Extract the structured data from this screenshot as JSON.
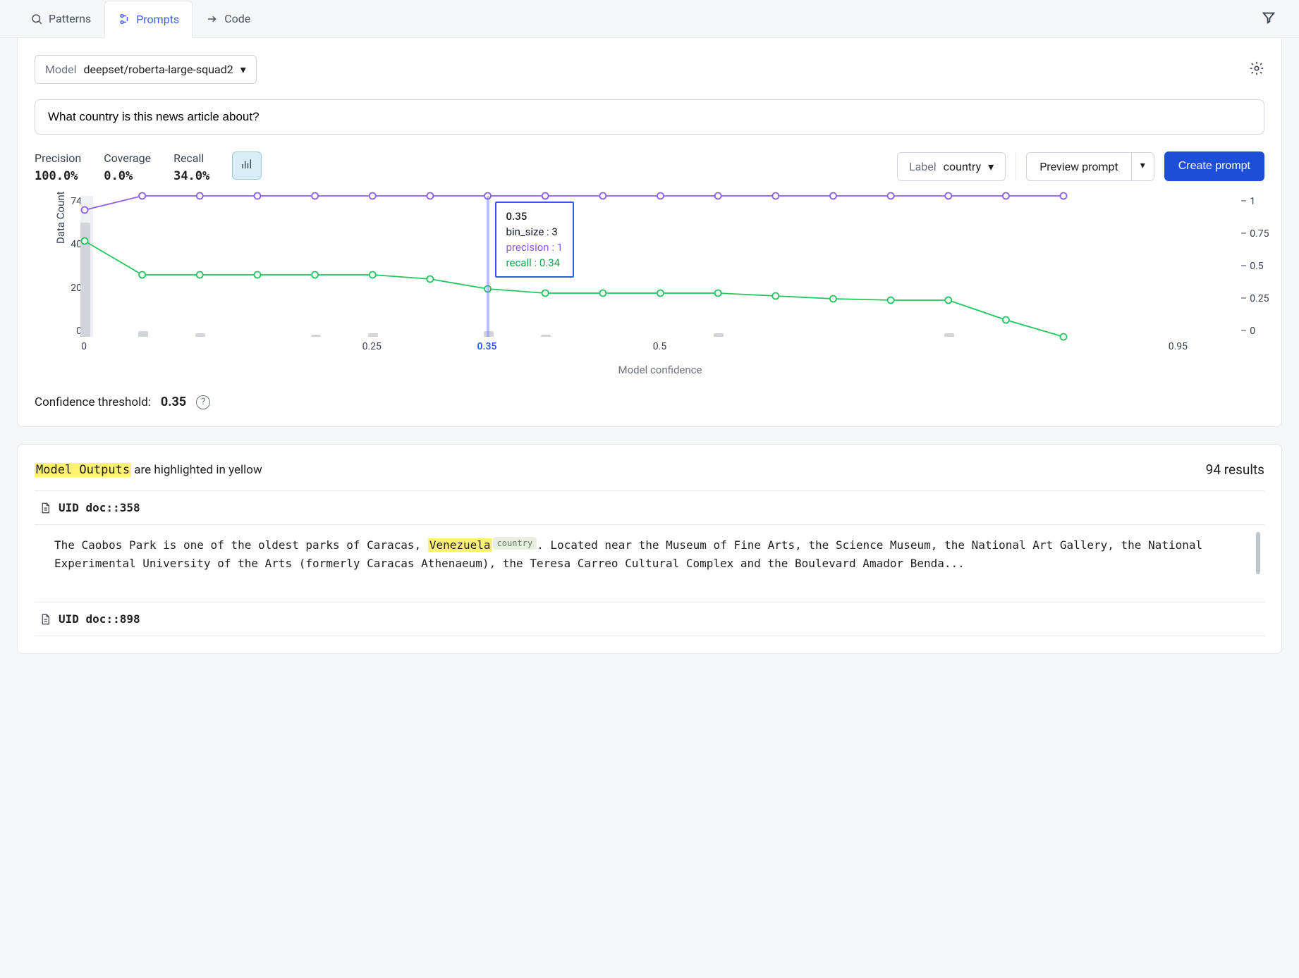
{
  "tabs": {
    "patterns": "Patterns",
    "prompts": "Prompts",
    "code": "Code"
  },
  "model": {
    "label": "Model",
    "value": "deepset/roberta-large-squad2"
  },
  "question": "What country is this news article about?",
  "metrics": {
    "precision_label": "Precision",
    "precision_value": "100.0%",
    "coverage_label": "Coverage",
    "coverage_value": "0.0%",
    "recall_label": "Recall",
    "recall_value": "34.0%"
  },
  "controls": {
    "label_label": "Label",
    "label_value": "country",
    "preview": "Preview prompt",
    "create": "Create prompt"
  },
  "chart_data": {
    "type": "line",
    "xlabel": "Model confidence",
    "ylabel_left": "Data Count",
    "y_left_ticks": [
      74,
      40,
      20,
      0
    ],
    "y_right_ticks": [
      1,
      0.75,
      0.5,
      0.25,
      0
    ],
    "x_ticks": [
      0,
      0.25,
      0.35,
      0.5,
      0.95
    ],
    "selected_x": 0.35,
    "x": [
      0.0,
      0.05,
      0.1,
      0.15,
      0.2,
      0.25,
      0.3,
      0.35,
      0.4,
      0.45,
      0.5,
      0.55,
      0.6,
      0.65,
      0.7,
      0.75,
      0.8,
      0.85
    ],
    "series": [
      {
        "name": "precision",
        "color": "#8b5cf6",
        "values": [
          0.9,
          1,
          1,
          1,
          1,
          1,
          1,
          1,
          1,
          1,
          1,
          1,
          1,
          1,
          1,
          1,
          1,
          1
        ]
      },
      {
        "name": "recall",
        "color": "#22c55e",
        "values": [
          0.68,
          0.44,
          0.44,
          0.44,
          0.44,
          0.44,
          0.41,
          0.34,
          0.31,
          0.31,
          0.31,
          0.31,
          0.29,
          0.27,
          0.26,
          0.26,
          0.12,
          0.0
        ]
      }
    ],
    "bins": [
      {
        "x": 0.0,
        "count": 60
      },
      {
        "x": 0.05,
        "count": 3
      },
      {
        "x": 0.1,
        "count": 2
      },
      {
        "x": 0.2,
        "count": 1
      },
      {
        "x": 0.25,
        "count": 2
      },
      {
        "x": 0.35,
        "count": 3
      },
      {
        "x": 0.4,
        "count": 1
      },
      {
        "x": 0.55,
        "count": 2
      },
      {
        "x": 0.75,
        "count": 2
      }
    ],
    "bin_max": 74,
    "tooltip": {
      "x": "0.35",
      "bin": "bin_size : 3",
      "precision": "precision : 1",
      "recall": "recall : 0.34"
    }
  },
  "threshold": {
    "label": "Confidence threshold:",
    "value": "0.35"
  },
  "results": {
    "legend_hl": "Model Outputs",
    "legend_rest": " are highlighted in yellow",
    "count": "94 results",
    "docs": [
      {
        "uid": "UID doc::358",
        "pre": "The Caobos Park is one of the oldest parks of Caracas, ",
        "highlight": "Venezuela",
        "tag": "country",
        "post": ". <EOS> Located near the Museum of Fine Arts, the Science Museum, the National Art Gallery, the National Experimental University of the Arts (formerly Caracas Athenaeum), the Teresa Carreo Cultural Complex and the Boulevard Amador Benda..."
      },
      {
        "uid": "UID doc::898",
        "pre": "",
        "highlight": "",
        "tag": "",
        "post": ""
      }
    ]
  }
}
